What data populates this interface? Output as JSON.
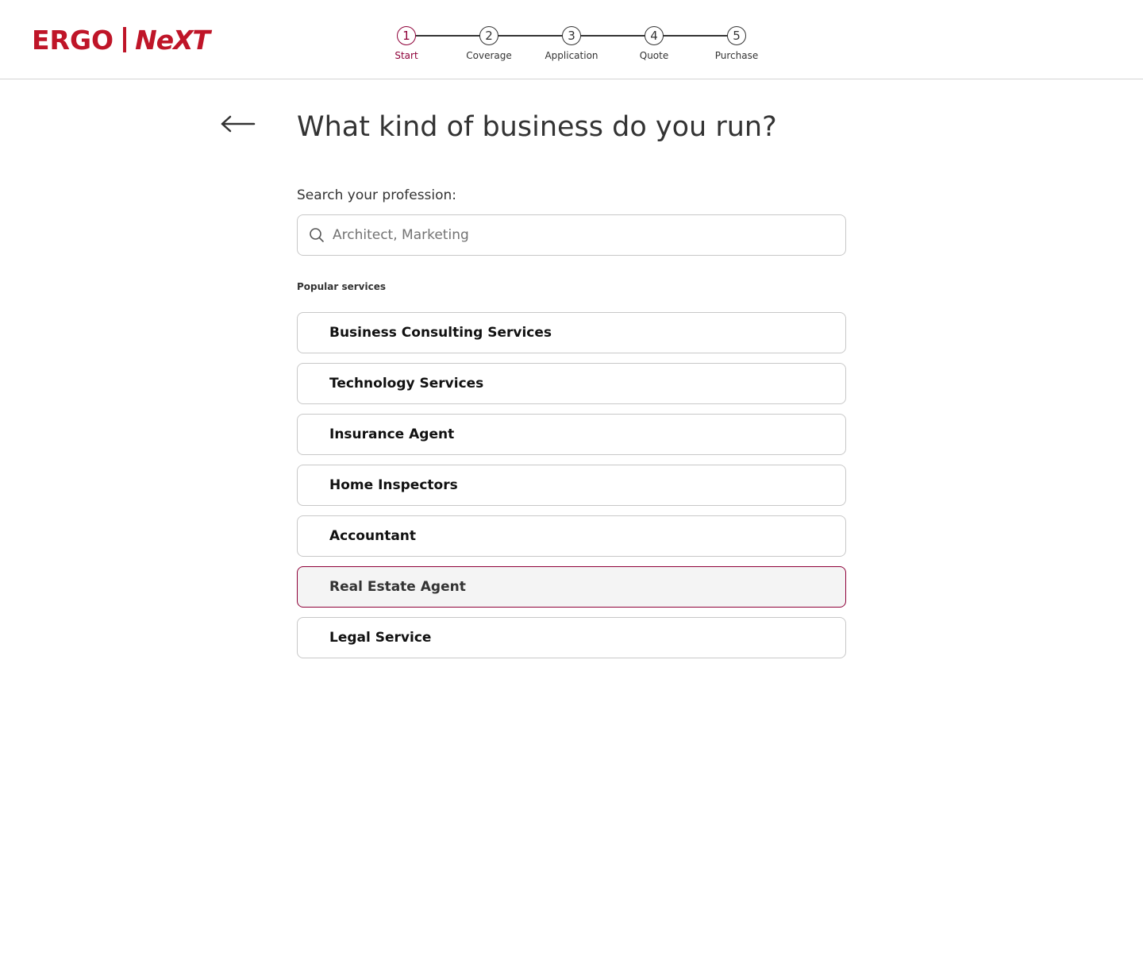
{
  "brand": {
    "left": "ERGO",
    "right": "NeXT",
    "color": "#bf1528"
  },
  "stepper": {
    "accent": "#8e0038",
    "steps": [
      {
        "number": "1",
        "label": "Start",
        "active": true
      },
      {
        "number": "2",
        "label": "Coverage",
        "active": false
      },
      {
        "number": "3",
        "label": "Application",
        "active": false
      },
      {
        "number": "4",
        "label": "Quote",
        "active": false
      },
      {
        "number": "5",
        "label": "Purchase",
        "active": false
      }
    ]
  },
  "page": {
    "back_icon": "arrow-left-icon",
    "title": "What kind of business do you run?"
  },
  "search": {
    "label": "Search your profession:",
    "placeholder": "Architect, Marketing",
    "value": "",
    "icon": "search-icon"
  },
  "popular": {
    "label": "Popular services",
    "items": [
      {
        "label": "Business Consulting Services",
        "selected": false
      },
      {
        "label": "Technology Services",
        "selected": false
      },
      {
        "label": "Insurance Agent",
        "selected": false
      },
      {
        "label": "Home Inspectors",
        "selected": false
      },
      {
        "label": "Accountant",
        "selected": false
      },
      {
        "label": "Real Estate Agent",
        "selected": true
      },
      {
        "label": "Legal Service",
        "selected": false
      }
    ]
  }
}
